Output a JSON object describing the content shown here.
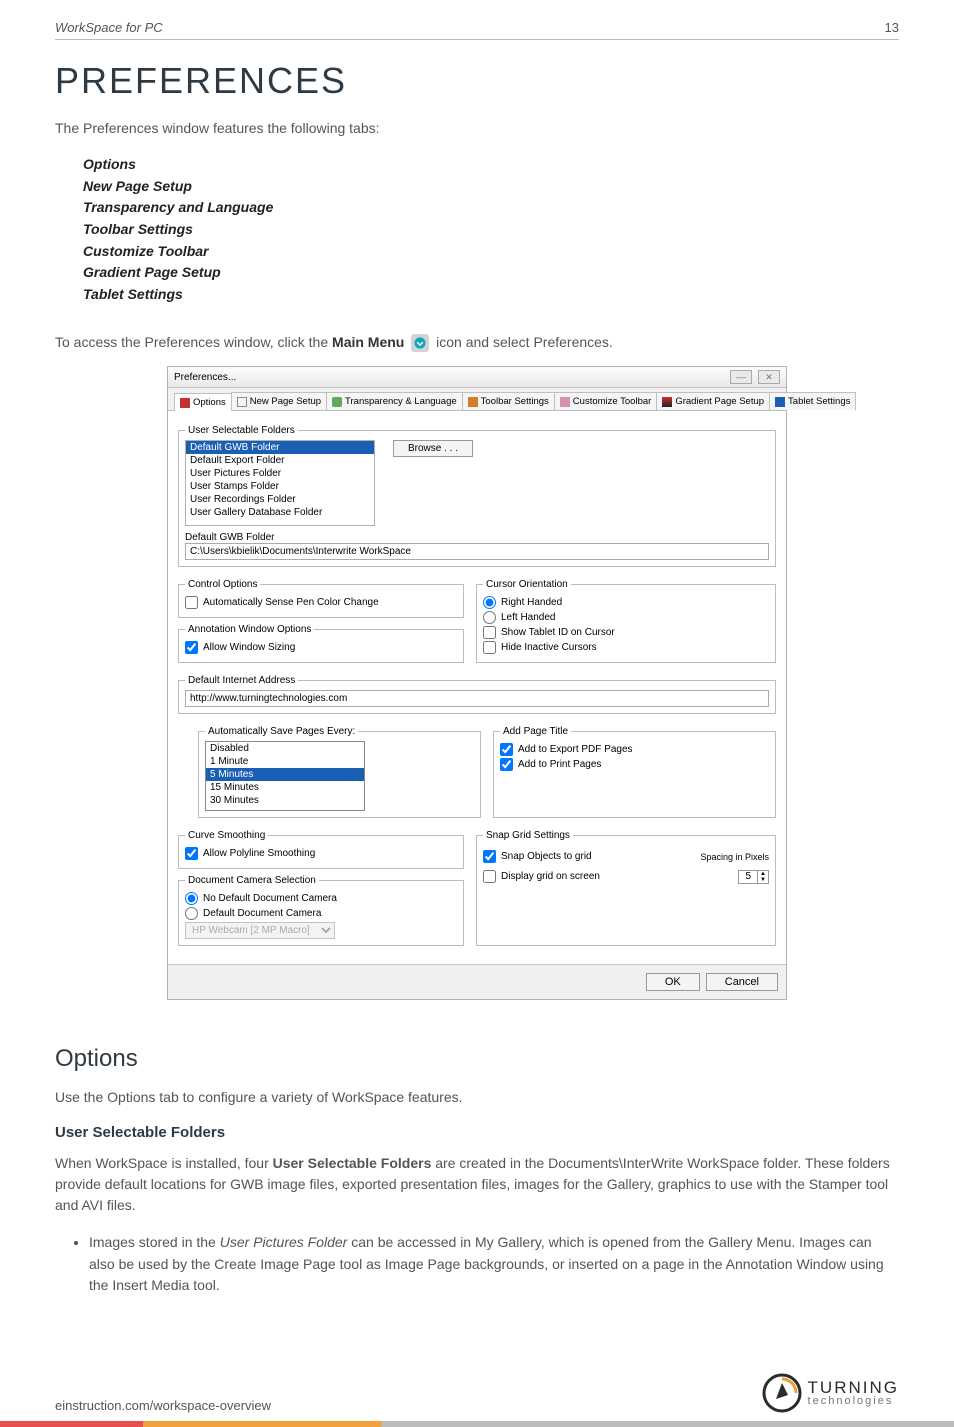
{
  "header": {
    "product": "WorkSpace for PC",
    "page_number": "13"
  },
  "title": "PREFERENCES",
  "intro": "The Preferences window features the following tabs:",
  "tabs_list": [
    "Options",
    "New Page Setup",
    "Transparency and Language",
    "Toolbar Settings",
    "Customize Toolbar",
    "Gradient Page Setup",
    "Tablet Settings"
  ],
  "access_line": {
    "pre": "To access the Preferences window, click the ",
    "main_menu": "Main Menu",
    "post": " icon and select Preferences."
  },
  "prefs_window": {
    "title": "Preferences...",
    "tabs": [
      "Options",
      "New Page Setup",
      "Transparency & Language",
      "Toolbar Settings",
      "Customize Toolbar",
      "Gradient Page Setup",
      "Tablet Settings"
    ],
    "user_selectable_folders": {
      "legend": "User Selectable Folders",
      "items": [
        "Default GWB Folder",
        "Default Export Folder",
        "User Pictures Folder",
        "User Stamps Folder",
        "User Recordings Folder",
        "User Gallery Database Folder"
      ],
      "selected_index": 0,
      "browse": "Browse . . .",
      "path_label": "Default GWB Folder",
      "path_value": "C:\\Users\\kbielik\\Documents\\Interwrite WorkSpace"
    },
    "control_options": {
      "legend": "Control Options",
      "auto_sense": {
        "label": "Automatically Sense Pen Color Change",
        "checked": false
      }
    },
    "annotation_window": {
      "legend": "Annotation Window Options",
      "allow_sizing": {
        "label": "Allow Window Sizing",
        "checked": true
      }
    },
    "cursor_orientation": {
      "legend": "Cursor Orientation",
      "right_handed": {
        "label": "Right Handed",
        "checked": true
      },
      "left_handed": {
        "label": "Left Handed",
        "checked": false
      },
      "show_tablet_id": {
        "label": "Show Tablet ID on Cursor",
        "checked": false
      },
      "hide_inactive": {
        "label": "Hide Inactive Cursors",
        "checked": false
      }
    },
    "default_internet": {
      "legend": "Default Internet Address",
      "value": "http://www.turningtechnologies.com"
    },
    "autosave": {
      "legend": "Automatically Save Pages Every:",
      "options": [
        "Disabled",
        "1 Minute",
        "5 Minutes",
        "15 Minutes",
        "30 Minutes"
      ],
      "selected_index": 2
    },
    "add_page_title": {
      "legend": "Add Page Title",
      "export_pdf": {
        "label": "Add to Export PDF Pages",
        "checked": true
      },
      "print_pages": {
        "label": "Add to Print Pages",
        "checked": true
      }
    },
    "curve_smoothing": {
      "legend": "Curve Smoothing",
      "allow_polyline": {
        "label": "Allow Polyline Smoothing",
        "checked": true
      }
    },
    "doc_camera": {
      "legend": "Document Camera Selection",
      "no_default": {
        "label": "No Default Document Camera",
        "checked": true
      },
      "default_cam": {
        "label": "Default Document Camera",
        "checked": false
      },
      "dropdown": "HP Webcam [2 MP Macro]"
    },
    "snap_grid": {
      "legend": "Snap Grid Settings",
      "snap_objects": {
        "label": "Snap Objects to grid",
        "checked": true
      },
      "display_grid": {
        "label": "Display grid on screen",
        "checked": false
      },
      "spacing_label": "Spacing in Pixels",
      "spacing_value": "5"
    },
    "buttons": {
      "ok": "OK",
      "cancel": "Cancel"
    }
  },
  "options_section": {
    "heading": "Options",
    "intro": "Use the Options tab to configure a variety of WorkSpace features.",
    "usf_heading": "User Selectable Folders",
    "usf_para_pre": "When WorkSpace is installed, four ",
    "usf_para_bold": "User Selectable Folders",
    "usf_para_post": " are created in the Documents\\InterWrite WorkSpace folder. These folders provide default locations for GWB image files, exported presentation files, images for the Gallery, graphics to use with the Stamper tool and AVI files.",
    "bullet_pre": "Images stored in the ",
    "bullet_ital": "User Pictures Folder",
    "bullet_post": " can be accessed in My Gallery, which is opened from the Gallery Menu. Images can also be used by the Create Image Page tool as Image Page backgrounds, or inserted on a page in the Annotation Window using the Insert Media tool."
  },
  "footer": {
    "url": "einstruction.com/workspace-overview",
    "logo_top": "TURNING",
    "logo_bottom": "technologies"
  }
}
